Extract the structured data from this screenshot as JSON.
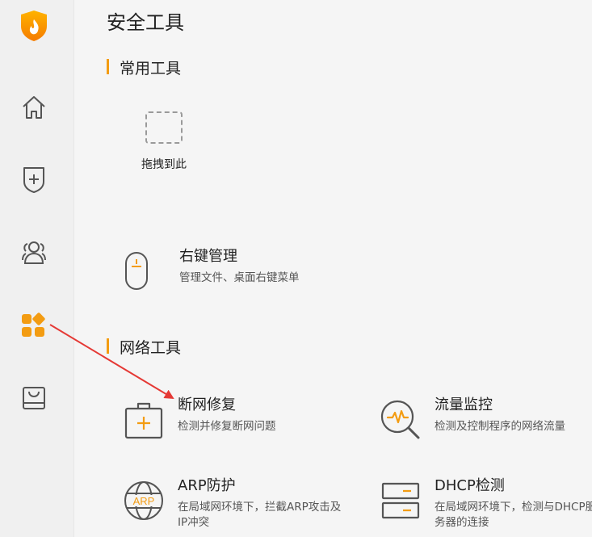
{
  "page": {
    "title": "安全工具"
  },
  "sections": {
    "common": {
      "title": "常用工具"
    },
    "network": {
      "title": "网络工具"
    }
  },
  "drop_slot": {
    "label": "拖拽到此"
  },
  "tools": {
    "right_click": {
      "name": "右键管理",
      "desc": "管理文件、桌面右键菜单"
    },
    "net_repair": {
      "name": "断网修复",
      "desc": "检测并修复断网问题"
    },
    "traffic": {
      "name": "流量监控",
      "desc": "检测及控制程序的网络流量"
    },
    "arp": {
      "name": "ARP防护",
      "desc": "在局域网环境下，拦截ARP攻击及IP冲突",
      "icon_text": "ARP"
    },
    "dhcp": {
      "name": "DHCP检测",
      "desc": "在局域网环境下，检测与DHCP服务器的连接"
    }
  },
  "icons": {
    "logo": "shield-flame-icon",
    "home": "home-icon",
    "protection": "shield-plus-icon",
    "users": "users-icon",
    "tools": "apps-icon",
    "box": "box-icon"
  },
  "colors": {
    "accent": "#f39c12",
    "arrow": "#e53935",
    "icon": "#555555"
  }
}
